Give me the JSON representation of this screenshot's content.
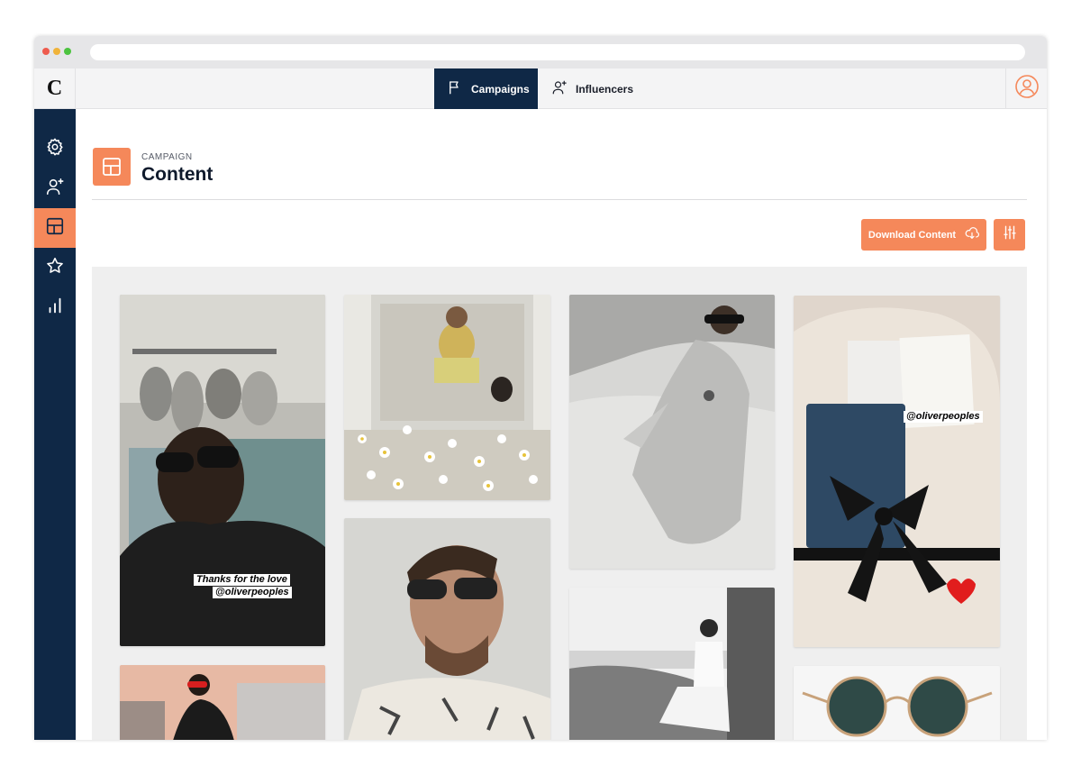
{
  "app": {
    "logo_letter": "C"
  },
  "topnav": {
    "tabs": [
      {
        "label": "Campaigns",
        "icon": "flag-icon",
        "active": true
      },
      {
        "label": "Influencers",
        "icon": "user-plus-icon",
        "active": false
      }
    ],
    "profile_icon": "user-circle-icon"
  },
  "sidebar": {
    "items": [
      {
        "name": "settings",
        "icon": "gear-icon",
        "active": false
      },
      {
        "name": "influencers",
        "icon": "user-plus-icon",
        "active": false
      },
      {
        "name": "content",
        "icon": "layout-grid-icon",
        "active": true
      },
      {
        "name": "favorites",
        "icon": "star-icon",
        "active": false
      },
      {
        "name": "analytics",
        "icon": "bar-chart-icon",
        "active": false
      }
    ]
  },
  "header": {
    "eyebrow": "CAMPAIGN",
    "title": "Content"
  },
  "toolbar": {
    "download_label": "Download Content",
    "download_icon": "cloud-download-icon",
    "filter_icon": "sliders-icon"
  },
  "gallery": {
    "posts": [
      {
        "name": "post-1",
        "caption_lines": [
          "Thanks for the love",
          "@oliverpeoples"
        ]
      },
      {
        "name": "post-2",
        "caption_lines": []
      },
      {
        "name": "post-3",
        "caption_lines": []
      },
      {
        "name": "post-4",
        "caption_lines": [
          "@oliverpeoples"
        ]
      },
      {
        "name": "post-5",
        "caption_lines": []
      },
      {
        "name": "post-6",
        "caption_lines": []
      },
      {
        "name": "post-7",
        "caption_lines": []
      },
      {
        "name": "post-8",
        "caption_lines": []
      }
    ]
  },
  "colors": {
    "brand_navy": "#0f2846",
    "accent_orange": "#f5885a",
    "gallery_bg": "#efefef"
  }
}
